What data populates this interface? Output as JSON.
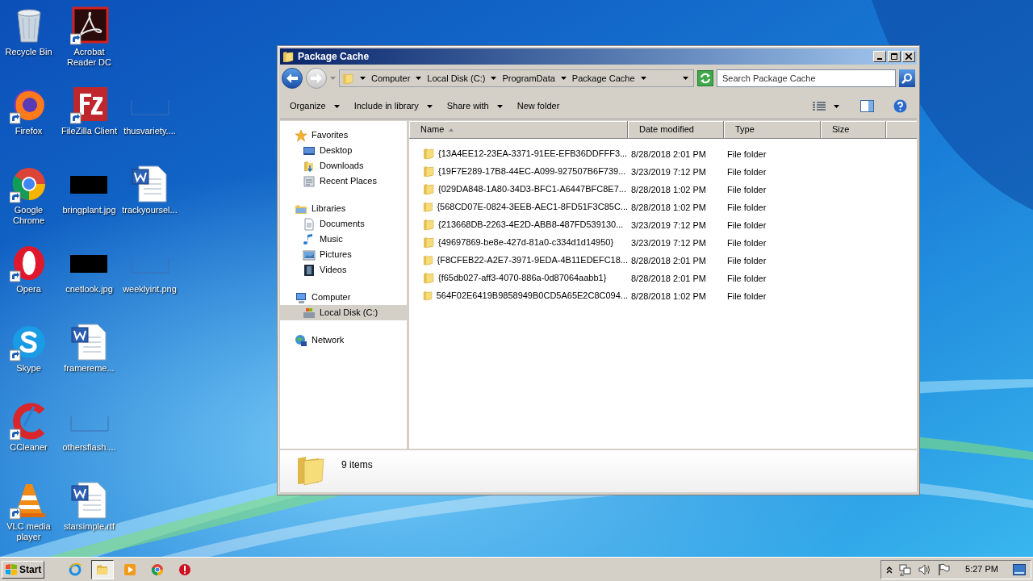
{
  "desktop": {
    "columns": [
      [
        {
          "label": "Recycle Bin",
          "kind": "recycle",
          "shortcut": false
        },
        {
          "label": "Firefox",
          "kind": "firefox",
          "shortcut": true
        },
        {
          "label": "Google Chrome",
          "kind": "chrome",
          "shortcut": true
        },
        {
          "label": "Opera",
          "kind": "opera",
          "shortcut": true
        },
        {
          "label": "Skype",
          "kind": "skype",
          "shortcut": true
        },
        {
          "label": "CCleaner",
          "kind": "ccleaner",
          "shortcut": true
        },
        {
          "label": "VLC media player",
          "kind": "vlc",
          "shortcut": true
        }
      ],
      [
        {
          "label": "Acrobat Reader DC",
          "kind": "acrobat",
          "shortcut": true
        },
        {
          "label": "FileZilla Client",
          "kind": "filezilla",
          "shortcut": true
        },
        {
          "label": "bringplant.jpg",
          "kind": "dark-image",
          "shortcut": false
        },
        {
          "label": "cnetlook.jpg",
          "kind": "dark-image",
          "shortcut": false
        },
        {
          "label": "framereme...",
          "kind": "document",
          "shortcut": false
        },
        {
          "label": "othersflash....",
          "kind": "blank",
          "shortcut": false
        },
        {
          "label": "starsimple.rtf",
          "kind": "document",
          "shortcut": false
        }
      ],
      [
        {
          "label": "thusvariety....",
          "kind": "blank",
          "shortcut": false
        },
        {
          "label": "trackyoursel...",
          "kind": "document",
          "shortcut": false
        },
        {
          "label": "weeklyint.png",
          "kind": "blank",
          "shortcut": false
        }
      ]
    ]
  },
  "window": {
    "title": "Package Cache",
    "breadcrumbs": [
      "Computer",
      "Local Disk (C:)",
      "ProgramData",
      "Package Cache"
    ],
    "search": {
      "placeholder": "Search Package Cache"
    },
    "toolbar": [
      {
        "label": "Organize",
        "dropdown": true
      },
      {
        "label": "Include in library",
        "dropdown": true
      },
      {
        "label": "Share with",
        "dropdown": true
      },
      {
        "label": "New folder",
        "dropdown": false
      }
    ],
    "nav": [
      {
        "label": "Favorites",
        "kind": "star",
        "selected": false,
        "children": [
          {
            "label": "Desktop",
            "kind": "desktop",
            "selected": false
          },
          {
            "label": "Downloads",
            "kind": "downloads",
            "selected": false
          },
          {
            "label": "Recent Places",
            "kind": "recent",
            "selected": false
          }
        ]
      },
      {
        "label": "Libraries",
        "kind": "library",
        "selected": false,
        "children": [
          {
            "label": "Documents",
            "kind": "documents",
            "selected": false
          },
          {
            "label": "Music",
            "kind": "music",
            "selected": false
          },
          {
            "label": "Pictures",
            "kind": "pictures",
            "selected": false
          },
          {
            "label": "Videos",
            "kind": "videos",
            "selected": false
          }
        ]
      },
      {
        "label": "Computer",
        "kind": "computer",
        "selected": false,
        "children": [
          {
            "label": "Local Disk (C:)",
            "kind": "disk",
            "selected": true
          }
        ]
      },
      {
        "label": "Network",
        "kind": "network",
        "selected": false
      }
    ],
    "table": {
      "columns": [
        {
          "label": "Name",
          "sorted": true
        },
        {
          "label": "Date modified",
          "sorted": false
        },
        {
          "label": "Type",
          "sorted": false
        },
        {
          "label": "Size",
          "sorted": false
        }
      ],
      "rows": [
        [
          "{13A4EE12-23EA-3371-91EE-EFB36DDFFF3...",
          "8/28/2018 2:01 PM",
          "File folder"
        ],
        [
          "{19F7E289-17B8-44EC-A099-927507B6F739...",
          "3/23/2019 7:12 PM",
          "File folder"
        ],
        [
          "{029DA848-1A80-34D3-BFC1-A6447BFC8E7...",
          "8/28/2018 1:02 PM",
          "File folder"
        ],
        [
          "{568CD07E-0824-3EEB-AEC1-8FD51F3C85C...",
          "8/28/2018 1:02 PM",
          "File folder"
        ],
        [
          "{213668DB-2263-4E2D-ABB8-487FD539130...",
          "3/23/2019 7:12 PM",
          "File folder"
        ],
        [
          "{49697869-be8e-427d-81a0-c334d1d14950}",
          "3/23/2019 7:12 PM",
          "File folder"
        ],
        [
          "{F8CFEB22-A2E7-3971-9EDA-4B11EDEFC18...",
          "8/28/2018 2:01 PM",
          "File folder"
        ],
        [
          "{f65db027-aff3-4070-886a-0d87064aabb1}",
          "8/28/2018 2:01 PM",
          "File folder"
        ],
        [
          "564F02E6419B9858949B0CD5A65E2C8C094...",
          "8/28/2018 1:02 PM",
          "File folder"
        ]
      ]
    },
    "details": {
      "count": "9 items"
    }
  },
  "taskbar": {
    "start": "Start",
    "apps": [
      {
        "kind": "ie",
        "selected": false
      },
      {
        "kind": "explorer",
        "selected": true
      },
      {
        "kind": "media",
        "selected": false
      },
      {
        "kind": "chrome",
        "selected": false
      },
      {
        "kind": "opera",
        "selected": false
      }
    ],
    "clock": "5:27 PM"
  }
}
